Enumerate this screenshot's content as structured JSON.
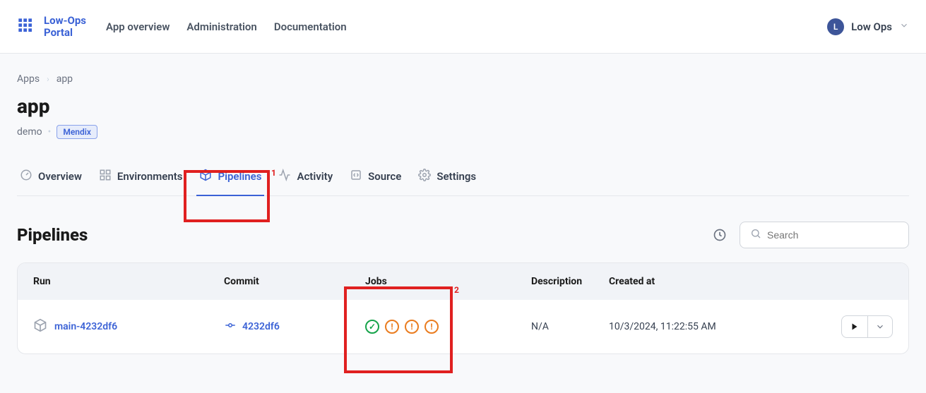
{
  "header": {
    "logo": {
      "line1": "Low-Ops",
      "line2": "Portal"
    },
    "nav": [
      "App overview",
      "Administration",
      "Documentation"
    ],
    "user": {
      "initial": "L",
      "name": "Low Ops"
    }
  },
  "breadcrumb": {
    "root": "Apps",
    "current": "app"
  },
  "page": {
    "title": "app",
    "owner": "demo",
    "badge": "Mendix"
  },
  "tabs": [
    {
      "icon": "speedometer",
      "label": "Overview"
    },
    {
      "icon": "grid",
      "label": "Environments"
    },
    {
      "icon": "cube",
      "label": "Pipelines",
      "active": true
    },
    {
      "icon": "activity",
      "label": "Activity"
    },
    {
      "icon": "source",
      "label": "Source"
    },
    {
      "icon": "gear",
      "label": "Settings"
    }
  ],
  "section": {
    "title": "Pipelines",
    "search_placeholder": "Search"
  },
  "table": {
    "headers": {
      "run": "Run",
      "commit": "Commit",
      "jobs": "Jobs",
      "desc": "Description",
      "created": "Created at"
    },
    "rows": [
      {
        "run": "main-4232df6",
        "commit": "4232df6",
        "jobs": [
          "success",
          "warn",
          "warn",
          "warn"
        ],
        "desc": "N/A",
        "created": "10/3/2024, 11:22:55 AM"
      }
    ]
  },
  "annotations": {
    "1": "1",
    "2": "2"
  }
}
